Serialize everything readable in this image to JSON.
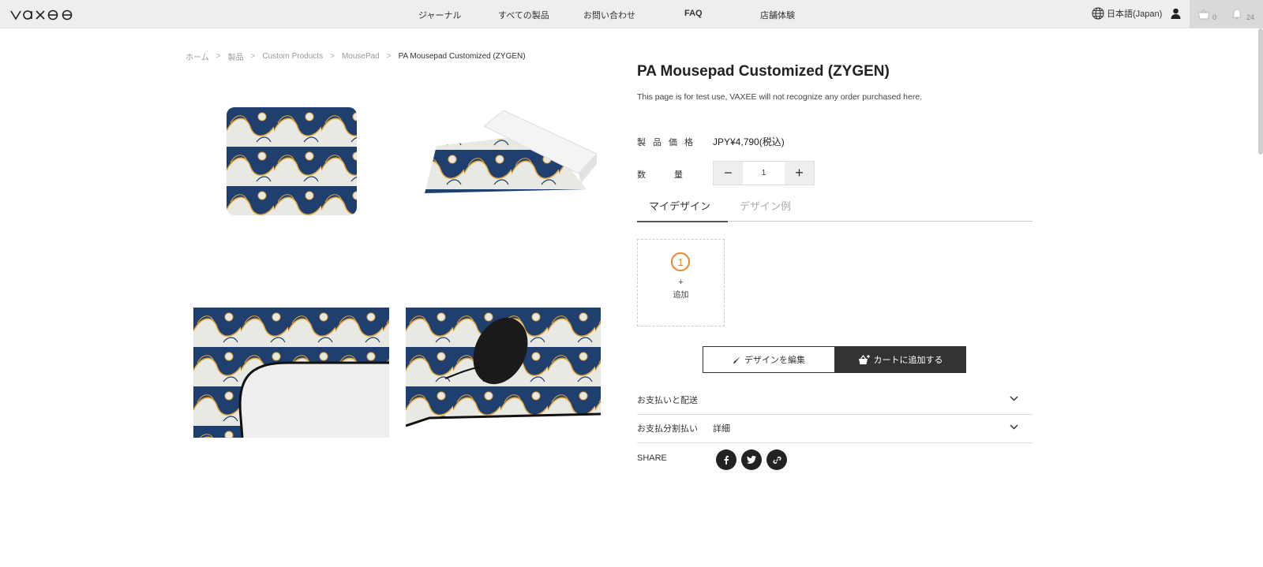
{
  "header": {
    "logo_text": "vaxee",
    "nav": [
      "ジャーナル",
      "すべての製品",
      "お問い合わせ",
      "FAQ",
      "店舗体験"
    ],
    "language": "日本語(Japan)",
    "cart_count": "0",
    "notification_count": "24"
  },
  "breadcrumb": [
    "ホーム",
    "製品",
    "Custom Products",
    "MousePad",
    "PA Mousepad Customized (ZYGEN)"
  ],
  "product": {
    "title": "PA Mousepad Customized (ZYGEN)",
    "description": "This page is for test use, VAXEE will not recognize any order purchased here.",
    "price_label": "製品価格",
    "price": "JPY¥4,790(税込)",
    "qty_label": "数量",
    "qty_minus": "−",
    "qty_value": "1",
    "qty_plus": "+"
  },
  "tabs": {
    "active": "マイデザイン",
    "inactive": "デザイン例"
  },
  "design_slot": {
    "number": "1",
    "plus": "+",
    "add_label": "追加"
  },
  "buttons": {
    "edit_design": "デザインを編集",
    "add_to_cart": "カートに追加する"
  },
  "accordion": {
    "payment_shipping": "お支払いと配送",
    "installment": "お支払分割払い",
    "installment_detail": "詳細"
  },
  "share": {
    "label": "SHARE",
    "icons": [
      "facebook-icon",
      "twitter-icon",
      "link-icon"
    ]
  },
  "colors": {
    "accent_orange": "#e8882a",
    "dark": "#333333",
    "wave_navy": "#1f3f6e",
    "wave_gold": "#e3a73a"
  }
}
